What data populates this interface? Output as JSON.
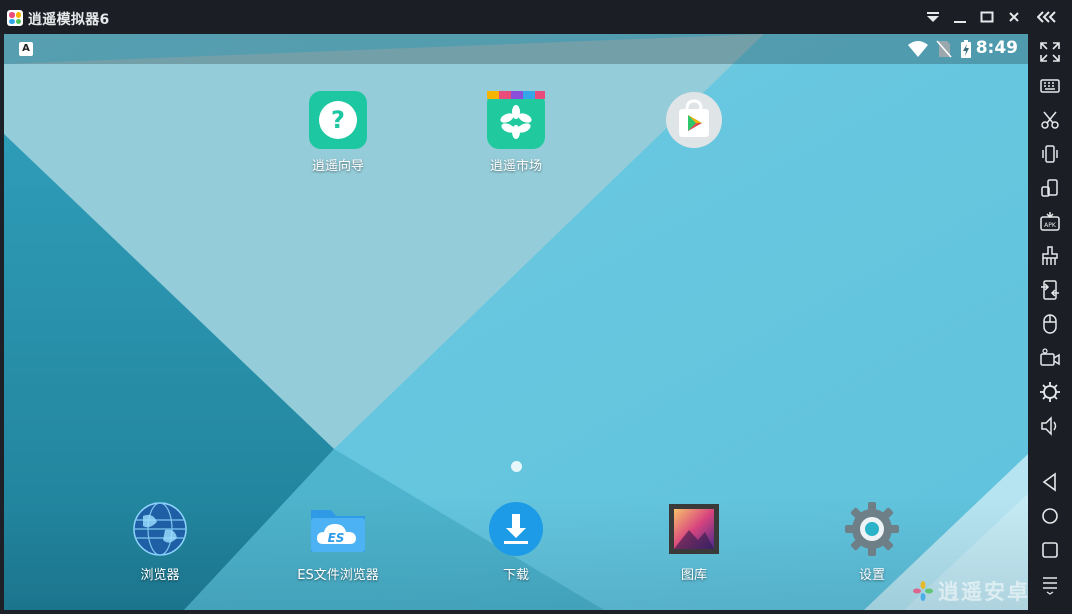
{
  "window": {
    "title": "逍遥模拟器6",
    "buttons": [
      "dropdown-menu-icon",
      "minimize-icon",
      "maximize-icon",
      "close-icon",
      "collapse-sidebar-icon"
    ]
  },
  "statusbar": {
    "indicator": "A",
    "time": "8:49",
    "icons": [
      "wifi-icon",
      "no-sim-icon",
      "battery-charging-icon"
    ]
  },
  "home_apps": [
    {
      "label": "逍遥向导",
      "icon": "question-icon"
    },
    {
      "label": "逍遥市场",
      "icon": "market-icon"
    },
    {
      "label": "",
      "icon": "play-store-icon"
    }
  ],
  "dock_apps": [
    {
      "label": "浏览器",
      "icon": "globe-icon"
    },
    {
      "label": "ES文件浏览器",
      "icon": "es-file-explorer-icon"
    },
    {
      "label": "下载",
      "icon": "download-icon"
    },
    {
      "label": "图库",
      "icon": "gallery-icon"
    },
    {
      "label": "设置",
      "icon": "settings-gear-icon"
    }
  ],
  "watermark": "逍遥安卓",
  "toolbar": [
    "fullscreen-icon",
    "keyboard-icon",
    "scissors-icon",
    "shake-icon",
    "rotate-icon",
    "apk-install-icon",
    "clean-icon",
    "shared-folder-icon",
    "mouse-icon",
    "video-record-icon",
    "settings-icon",
    "volume-icon",
    "back-icon",
    "home-icon",
    "recent-apps-icon",
    "menu-icon"
  ],
  "colors": {
    "window_bg": "#1b1f25",
    "wallpaper_light": "#69c8e0",
    "wallpaper_dark": "#2b93ad",
    "wallpaper_pale": "#9fd2df"
  }
}
